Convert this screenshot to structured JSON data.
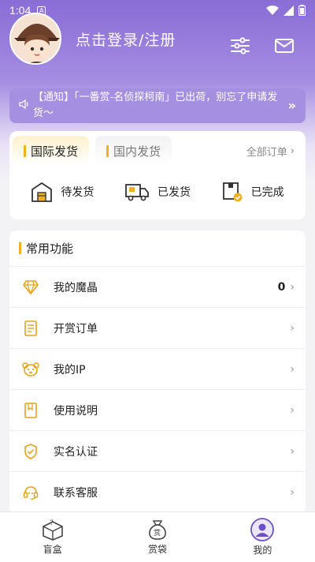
{
  "status_bar": {
    "time": "1:04",
    "sim": "A"
  },
  "header": {
    "login_label": "点击登录/注册"
  },
  "notice": {
    "text": "【通知】「一番赏-名侦探柯南」已出荷，别忘了申请发货～"
  },
  "shipping": {
    "tabs": [
      {
        "label": "国际发货",
        "active": true
      },
      {
        "label": "国内发货",
        "active": false
      }
    ],
    "all_orders": "全部订单",
    "items": [
      {
        "label": "待发货",
        "icon": "warehouse-icon"
      },
      {
        "label": "已发货",
        "icon": "truck-icon"
      },
      {
        "label": "已完成",
        "icon": "completed-box-icon"
      }
    ]
  },
  "functions": {
    "title": "常用功能",
    "items": [
      {
        "label": "我的魔晶",
        "value": "0",
        "icon": "diamond-icon"
      },
      {
        "label": "开赏订单",
        "value": "",
        "icon": "order-list-icon"
      },
      {
        "label": "我的IP",
        "value": "",
        "icon": "bear-icon"
      },
      {
        "label": "使用说明",
        "value": "",
        "icon": "manual-icon"
      },
      {
        "label": "实名认证",
        "value": "",
        "icon": "shield-check-icon"
      },
      {
        "label": "联系客服",
        "value": "",
        "icon": "customer-service-icon"
      }
    ]
  },
  "bottom_nav": [
    {
      "label": "盲盒",
      "icon": "mystery-box-icon"
    },
    {
      "label": "赏袋",
      "icon": "prize-bag-icon"
    },
    {
      "label": "我的",
      "icon": "profile-icon"
    }
  ],
  "colors": {
    "accent": "#f2b01e",
    "purple": "#8a6cd6",
    "notice_bg": "#a58fe0"
  }
}
